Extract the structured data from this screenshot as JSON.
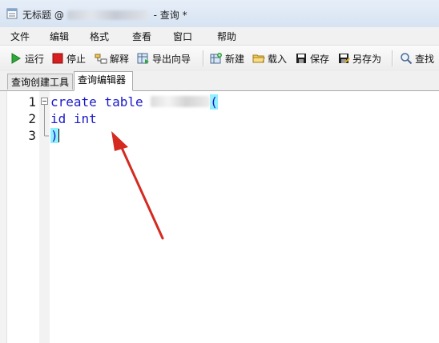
{
  "window": {
    "title_prefix": "无标题 @",
    "title_suffix": " - 查询 *"
  },
  "menu": [
    "文件",
    "编辑",
    "格式",
    "查看",
    "窗口",
    "帮助"
  ],
  "toolbar": {
    "run": "运行",
    "stop": "停止",
    "explain": "解释",
    "export_wizard": "导出向导",
    "new": "新建",
    "load": "载入",
    "save": "保存",
    "save_as": "另存为",
    "find": "查找"
  },
  "tabs": [
    "查询创建工具",
    "查询编辑器"
  ],
  "editor": {
    "line_numbers": [
      "1",
      "2",
      "3"
    ],
    "lines": [
      {
        "text": "create table ",
        "after": "("
      },
      {
        "text": "id int"
      },
      {
        "text": ")"
      }
    ]
  },
  "colors": {
    "keyword": "#1a1ac8",
    "bracket_highlight": "#8ff1ff",
    "annotation_arrow": "#d42a20"
  }
}
